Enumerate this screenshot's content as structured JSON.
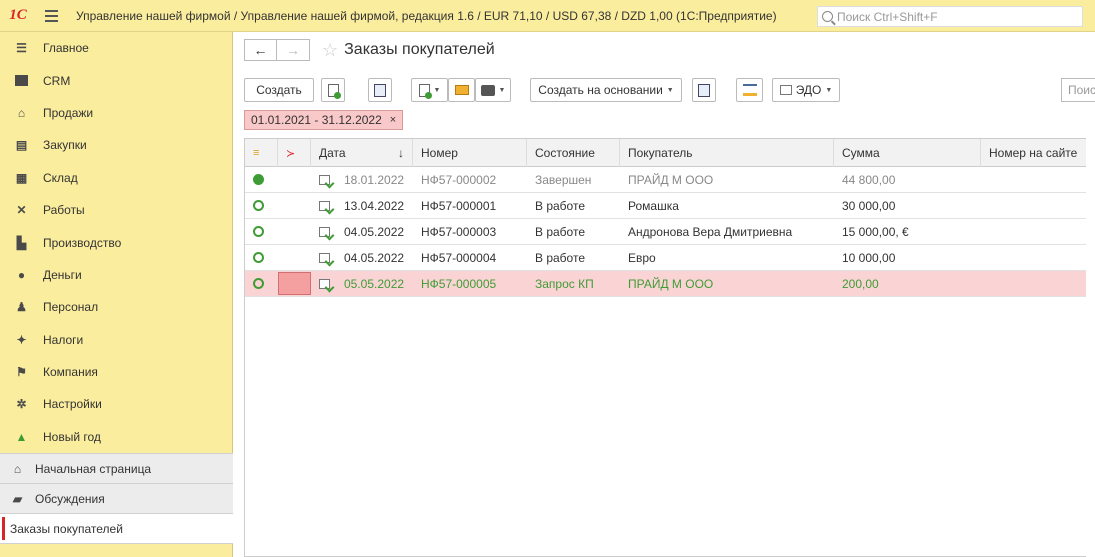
{
  "topbar": {
    "logo": "1С",
    "title": "Управление нашей фирмой / Управление нашей фирмой, редакция 1.6 / EUR 71,10 / USD 67,38 / DZD 1,00  (1С:Предприятие)",
    "search_placeholder": "Поиск Ctrl+Shift+F"
  },
  "sidebar": {
    "items": [
      {
        "label": "Главное",
        "icon": "menu-lines-icon"
      },
      {
        "label": "CRM",
        "icon": "crm-icon"
      },
      {
        "label": "Продажи",
        "icon": "sales-icon"
      },
      {
        "label": "Закупки",
        "icon": "purchases-icon"
      },
      {
        "label": "Склад",
        "icon": "warehouse-icon"
      },
      {
        "label": "Работы",
        "icon": "tools-icon"
      },
      {
        "label": "Производство",
        "icon": "factory-icon"
      },
      {
        "label": "Деньги",
        "icon": "money-icon"
      },
      {
        "label": "Персонал",
        "icon": "personnel-icon"
      },
      {
        "label": "Налоги",
        "icon": "taxes-icon"
      },
      {
        "label": "Компания",
        "icon": "flag-icon"
      },
      {
        "label": "Настройки",
        "icon": "gear-icon"
      },
      {
        "label": "Новый год",
        "icon": "tree-icon"
      }
    ],
    "home": "Начальная страница",
    "discussions": "Обсуждения",
    "open_tab": "Заказы покупателей"
  },
  "header": {
    "title": "Заказы покупателей",
    "back": "←",
    "forward": "→",
    "star": "☆"
  },
  "toolbar": {
    "create": "Создать",
    "create_based_on": "Создать на основании",
    "edo": "ЭДО",
    "search_placeholder": "Поиск"
  },
  "filter": {
    "period": "01.01.2021 - 31.12.2022",
    "remove": "×"
  },
  "table": {
    "columns": {
      "date": "Дата",
      "sort_arrow": "↓",
      "number": "Номер",
      "status": "Состояние",
      "buyer": "Покупатель",
      "sum": "Сумма",
      "site_number": "Номер на сайте"
    },
    "rows": [
      {
        "done": true,
        "date": "18.01.2022",
        "number": "НФ57-000002",
        "status": "Завершен",
        "buyer": "ПРАЙД М ООО",
        "sum": "44 800,00",
        "site": ""
      },
      {
        "done": false,
        "date": "13.04.2022",
        "number": "НФ57-000001",
        "status": "В работе",
        "buyer": "Ромашка",
        "sum": "30 000,00",
        "site": ""
      },
      {
        "done": false,
        "date": "04.05.2022",
        "number": "НФ57-000003",
        "status": "В работе",
        "buyer": "Андронова Вера Дмитриевна",
        "sum": "15 000,00, €",
        "site": ""
      },
      {
        "done": false,
        "date": "04.05.2022",
        "number": "НФ57-000004",
        "status": "В работе",
        "buyer": "Евро",
        "sum": "10 000,00",
        "site": ""
      },
      {
        "done": false,
        "date": "05.05.2022",
        "number": "НФ57-000005",
        "status": "Запрос КП",
        "buyer": "ПРАЙД М ООО",
        "sum": "200,00",
        "site": ""
      }
    ]
  },
  "colors": {
    "accent_yellow": "#fbed9e",
    "selection_pink": "#fad4d4",
    "status_green": "#3f9c35",
    "logo_red": "#d8252b"
  }
}
